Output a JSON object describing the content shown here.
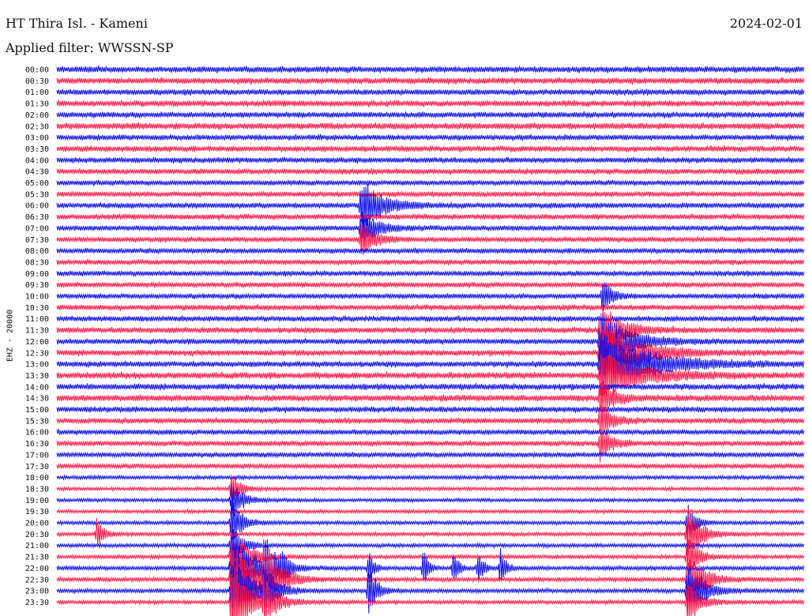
{
  "header": {
    "station": "HT Thira Isl. - Kameni",
    "date": "2024-02-01",
    "filter": "Applied filter: WWSSN-SP",
    "channel": "EHZ - 20000"
  },
  "colors": {
    "blue": "#1010e6",
    "red": "#ff1a4a",
    "text": "#111111",
    "background": "#ffffff"
  },
  "chart_data": {
    "type": "line",
    "title": "HT Thira Isl. - Kameni",
    "ylabel": "EHZ - 20000",
    "xlabel": "",
    "grid": false,
    "legend": "none",
    "x_unit": "minutes",
    "x_range": [
      0,
      30
    ],
    "trace_colors": [
      "#1010e6",
      "#ff1a4a"
    ],
    "row_labels": [
      "00:00",
      "00:30",
      "01:00",
      "01:30",
      "02:00",
      "02:30",
      "03:00",
      "03:30",
      "04:00",
      "04:30",
      "05:00",
      "05:30",
      "06:00",
      "06:30",
      "07:00",
      "07:30",
      "08:00",
      "08:30",
      "09:00",
      "09:30",
      "10:00",
      "10:30",
      "11:00",
      "11:30",
      "12:00",
      "12:30",
      "13:00",
      "13:30",
      "14:00",
      "14:30",
      "15:00",
      "15:30",
      "16:00",
      "16:30",
      "17:00",
      "17:30",
      "18:00",
      "18:30",
      "19:00",
      "19:30",
      "20:00",
      "20:30",
      "21:00",
      "21:30",
      "22:00",
      "22:30",
      "23:00",
      "23:30"
    ],
    "noise_level": [
      1.0,
      1.0,
      0.95,
      1.0,
      0.95,
      1.05,
      0.9,
      0.95,
      0.9,
      0.9,
      0.85,
      0.85,
      0.9,
      0.9,
      0.85,
      0.85,
      0.85,
      0.85,
      0.85,
      0.85,
      0.85,
      0.9,
      0.9,
      0.95,
      0.9,
      0.95,
      0.95,
      1.05,
      1.0,
      1.05,
      0.95,
      0.9,
      0.85,
      0.85,
      0.8,
      0.75,
      0.6,
      0.55,
      0.55,
      0.55,
      0.6,
      0.6,
      0.6,
      0.6,
      0.65,
      0.65,
      0.65,
      0.6
    ],
    "events": [
      {
        "row": 12,
        "minute": 12.2,
        "amplitude": 2.5,
        "duration": 1.5
      },
      {
        "row": 14,
        "minute": 12.2,
        "amplitude": 1.5,
        "duration": 1.2
      },
      {
        "row": 15,
        "minute": 12.2,
        "amplitude": 1.5,
        "duration": 1.0
      },
      {
        "row": 20,
        "minute": 21.9,
        "amplitude": 1.6,
        "duration": 0.6
      },
      {
        "row": 23,
        "minute": 21.8,
        "amplitude": 2.5,
        "duration": 1.5
      },
      {
        "row": 24,
        "minute": 21.8,
        "amplitude": 2.8,
        "duration": 2.0
      },
      {
        "row": 25,
        "minute": 21.8,
        "amplitude": 3.0,
        "duration": 2.5
      },
      {
        "row": 26,
        "minute": 21.8,
        "amplitude": 3.0,
        "duration": 3.5
      },
      {
        "row": 27,
        "minute": 21.8,
        "amplitude": 2.0,
        "duration": 3.0
      },
      {
        "row": 29,
        "minute": 21.8,
        "amplitude": 1.6,
        "duration": 1.0
      },
      {
        "row": 31,
        "minute": 21.8,
        "amplitude": 1.8,
        "duration": 0.8
      },
      {
        "row": 33,
        "minute": 21.8,
        "amplitude": 1.6,
        "duration": 0.8
      },
      {
        "row": 37,
        "minute": 7.0,
        "amplitude": 1.6,
        "duration": 0.6
      },
      {
        "row": 38,
        "minute": 7.0,
        "amplitude": 1.8,
        "duration": 0.8
      },
      {
        "row": 40,
        "minute": 7.0,
        "amplitude": 2.0,
        "duration": 0.8
      },
      {
        "row": 40,
        "minute": 25.3,
        "amplitude": 1.8,
        "duration": 0.6
      },
      {
        "row": 41,
        "minute": 1.6,
        "amplitude": 1.4,
        "duration": 0.5
      },
      {
        "row": 41,
        "minute": 25.3,
        "amplitude": 2.5,
        "duration": 1.0
      },
      {
        "row": 42,
        "minute": 7.0,
        "amplitude": 2.0,
        "duration": 0.8
      },
      {
        "row": 43,
        "minute": 7.0,
        "amplitude": 2.8,
        "duration": 1.2
      },
      {
        "row": 43,
        "minute": 25.3,
        "amplitude": 2.0,
        "duration": 0.8
      },
      {
        "row": 44,
        "minute": 7.0,
        "amplitude": 3.5,
        "duration": 1.5
      },
      {
        "row": 44,
        "minute": 8.3,
        "amplitude": 2.5,
        "duration": 0.9
      },
      {
        "row": 44,
        "minute": 9.0,
        "amplitude": 1.5,
        "duration": 0.4
      },
      {
        "row": 44,
        "minute": 12.5,
        "amplitude": 1.4,
        "duration": 0.4
      },
      {
        "row": 44,
        "minute": 14.7,
        "amplitude": 1.6,
        "duration": 0.4
      },
      {
        "row": 44,
        "minute": 15.9,
        "amplitude": 1.6,
        "duration": 0.4
      },
      {
        "row": 44,
        "minute": 16.9,
        "amplitude": 1.5,
        "duration": 0.4
      },
      {
        "row": 44,
        "minute": 17.8,
        "amplitude": 1.6,
        "duration": 0.4
      },
      {
        "row": 45,
        "minute": 7.0,
        "amplitude": 3.5,
        "duration": 1.8
      },
      {
        "row": 45,
        "minute": 8.3,
        "amplitude": 3.0,
        "duration": 1.0
      },
      {
        "row": 45,
        "minute": 25.3,
        "amplitude": 2.5,
        "duration": 1.2
      },
      {
        "row": 46,
        "minute": 7.0,
        "amplitude": 3.0,
        "duration": 1.5
      },
      {
        "row": 46,
        "minute": 8.3,
        "amplitude": 2.0,
        "duration": 0.8
      },
      {
        "row": 46,
        "minute": 12.5,
        "amplitude": 2.4,
        "duration": 0.6
      },
      {
        "row": 46,
        "minute": 25.3,
        "amplitude": 2.8,
        "duration": 1.2
      },
      {
        "row": 47,
        "minute": 7.0,
        "amplitude": 3.5,
        "duration": 1.5
      },
      {
        "row": 47,
        "minute": 8.3,
        "amplitude": 2.0,
        "duration": 0.8
      },
      {
        "row": 47,
        "minute": 25.3,
        "amplitude": 2.0,
        "duration": 1.0
      }
    ]
  }
}
